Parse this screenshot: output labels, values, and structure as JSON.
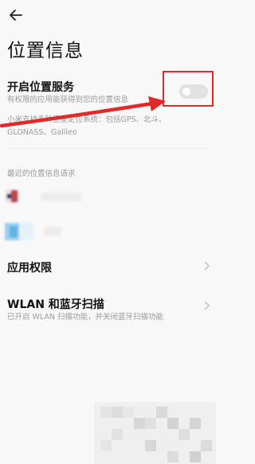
{
  "header": {
    "back_icon": "back-arrow-icon",
    "title": "位置信息"
  },
  "location_service": {
    "title": "开启位置服务",
    "subtitle": "有权限的应用能获得到您的位置信息",
    "description": "小米支持多种卫星定位系统：包括GPS、北斗、GLONASS、Galileo",
    "enabled": false
  },
  "recent": {
    "title": "最近的位置信息请求"
  },
  "app_permissions": {
    "title": "应用权限"
  },
  "wlan_bt": {
    "title": "WLAN 和蓝牙扫描",
    "subtitle": "已开启 WLAN 扫描功能，并关闭蓝牙扫描功能"
  },
  "colors": {
    "background": "#f8f8f8",
    "annotation_red": "#e02a2a",
    "toggle_off": "#e1e1e1",
    "secondary_text": "#9a9a9a"
  }
}
